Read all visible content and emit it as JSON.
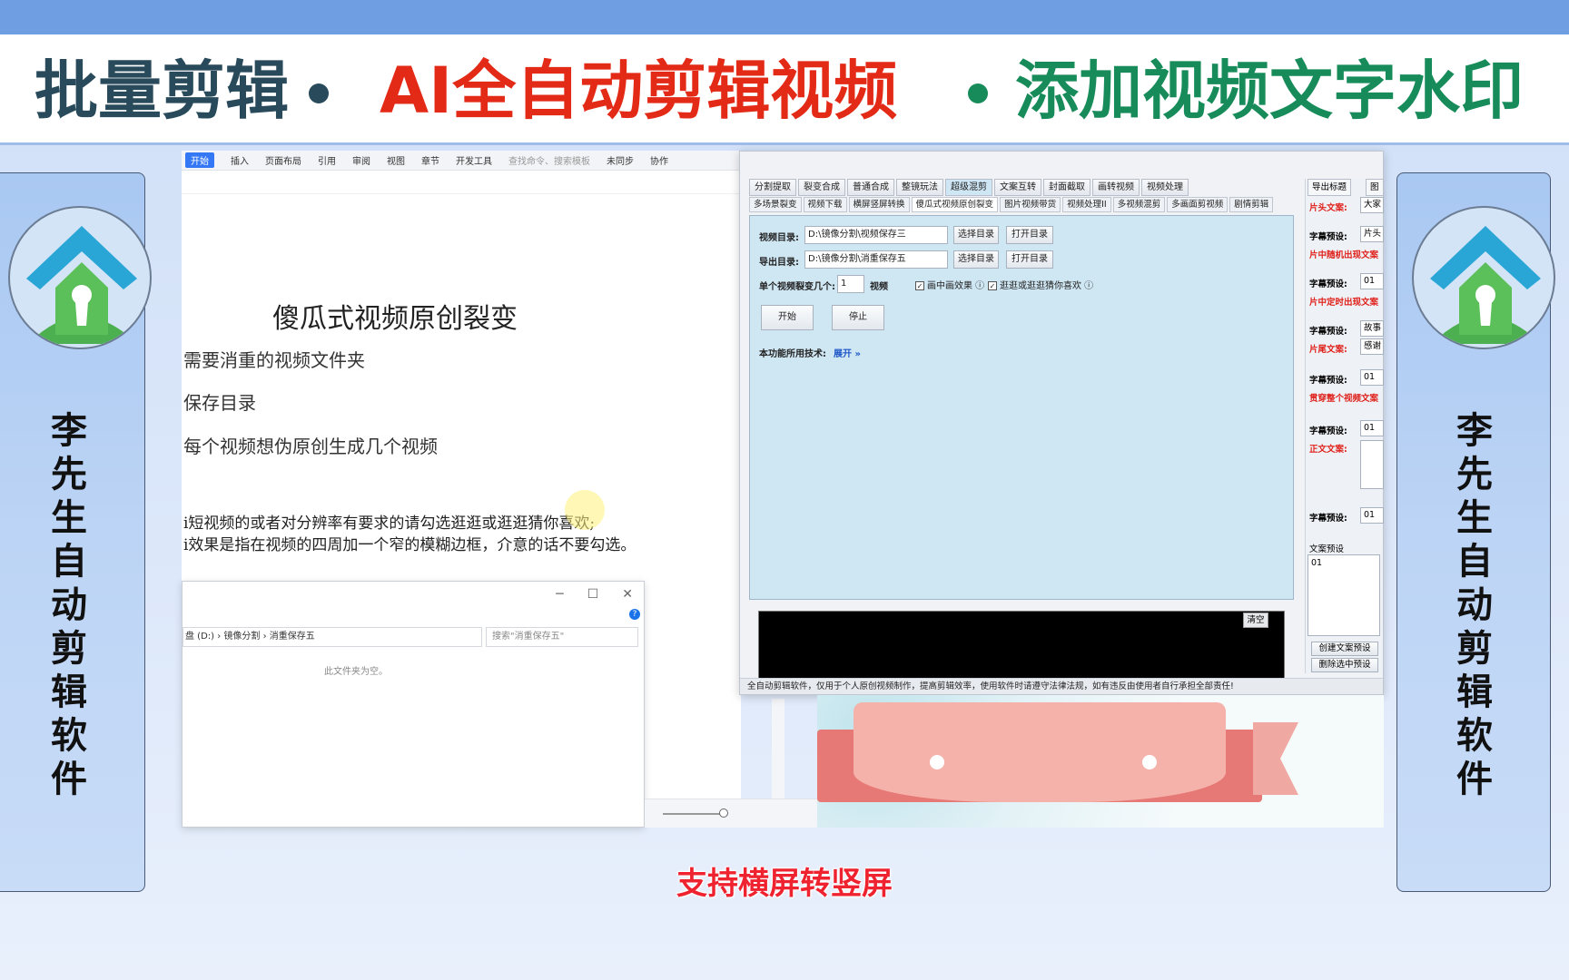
{
  "banner": {
    "left": "批量剪辑",
    "center": "AI全自动剪辑视频",
    "right": "添加视频文字水印"
  },
  "side": {
    "chars": [
      "李",
      "先",
      "生",
      "自",
      "动",
      "剪",
      "辑",
      "软",
      "件"
    ]
  },
  "doc": {
    "ribbon": [
      "开始",
      "插入",
      "页面布局",
      "引用",
      "审阅",
      "视图",
      "章节",
      "开发工具",
      "查找命令、搜索模板",
      "未同步",
      "协作"
    ],
    "title": "傻瓜式视频原创裂变",
    "lines": [
      "需要消重的视频文件夹",
      "保存目录",
      "每个视频想伪原创生成几个视频",
      "i短视频的或者对分辨率有要求的请勾选逛逛或逛逛猜你喜欢;",
      "i效果是指在视频的四周加一个窄的模糊边框，介意的话不要勾选。"
    ]
  },
  "explorer": {
    "address": "盘 (D:) › 镜像分割 › 消重保存五",
    "search_placeholder": "搜索\"消重保存五\"",
    "empty_text": "此文件夹为空。"
  },
  "app": {
    "tabs": [
      "分割提取",
      "裂变合成",
      "普通合成",
      "整镜玩法",
      "超级混剪",
      "文案互转",
      "封面截取",
      "画转视频",
      "视频处理"
    ],
    "subtabs": [
      "多场景裂变",
      "视频下载",
      "横屏竖屏转换",
      "傻瓜式视频原创裂变",
      "图片视频带货",
      "视频处理II",
      "多视频混剪",
      "多画面剪视频",
      "剧情剪辑"
    ],
    "video_dir_label": "视频目录:",
    "video_dir_value": "D:\\镜像分割\\视频保存三",
    "export_dir_label": "导出目录:",
    "export_dir_value": "D:\\镜像分割\\消重保存五",
    "select_dir": "选择目录",
    "open_dir": "打开目录",
    "count_label": "单个视频裂变几个:",
    "count_value": "1",
    "count_unit": "视频",
    "chk1": "画中画效果",
    "chk2": "逛逛或逛逛猜你喜欢",
    "start": "开始",
    "stop": "停止",
    "tech_label": "本功能所用技术:",
    "tech_link": "展开",
    "clear": "清空",
    "footer": "全自动剪辑软件，仅用于个人原创视频制作，提高剪辑效率，使用软件时请遵守法律法规，如有违反由使用者自行承担全部责任!"
  },
  "right_panel": {
    "tab1": "导出标题",
    "tab2": "图",
    "items": [
      {
        "label": "片头文案:",
        "red": true,
        "value": "大家"
      },
      {
        "label": "字幕预设:",
        "red": false,
        "value": "片头"
      },
      {
        "label": "片中随机出现文案",
        "red": true,
        "value": ""
      },
      {
        "label": "字幕预设:",
        "red": false,
        "value": "01"
      },
      {
        "label": "片中定时出现文案",
        "red": true,
        "value": ""
      },
      {
        "label": "字幕预设:",
        "red": false,
        "value": "故事"
      },
      {
        "label": "片尾文案:",
        "red": true,
        "value": "感谢"
      },
      {
        "label": "字幕预设:",
        "red": false,
        "value": "01"
      },
      {
        "label": "贯穿整个视频文案",
        "red": true,
        "value": ""
      },
      {
        "label": "字幕预设:",
        "red": false,
        "value": "01"
      },
      {
        "label": "正文文案:",
        "red": true,
        "value": ""
      },
      {
        "label": "字幕预设:",
        "red": false,
        "value": "01"
      }
    ],
    "preset_label": "文案预设",
    "preset_value": "01",
    "btn_create": "创建文案预设",
    "btn_delete": "删除选中预设"
  },
  "caption": "支持横屏转竖屏"
}
